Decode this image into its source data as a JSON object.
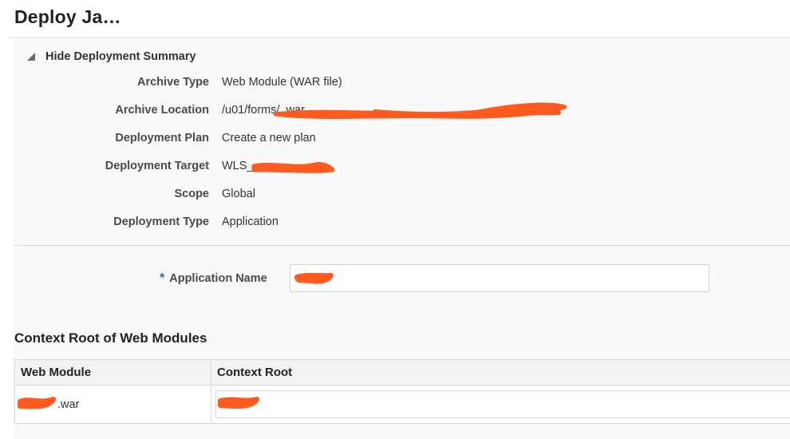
{
  "page": {
    "title": "Deploy Ja…"
  },
  "summary": {
    "toggle_label": "Hide Deployment Summary",
    "rows": [
      {
        "label": "Archive Type",
        "value": "Web Module (WAR file)"
      },
      {
        "label": "Archive Location",
        "value": "/u01/forms/                                                    .war"
      },
      {
        "label": "Deployment Plan",
        "value": "Create a new plan"
      },
      {
        "label": "Deployment Target",
        "value": "WLS_"
      },
      {
        "label": "Scope",
        "value": "Global"
      },
      {
        "label": "Deployment Type",
        "value": "Application"
      }
    ]
  },
  "app_name": {
    "required_marker": "*",
    "label": "Application Name",
    "value": ""
  },
  "context_root": {
    "heading": "Context Root of Web Modules",
    "columns": [
      "Web Module",
      "Context Root"
    ],
    "rows": [
      {
        "web_module": ".war",
        "context_root": ""
      }
    ]
  },
  "colors": {
    "redaction": "#ff5a1f",
    "required": "#1a6ecf"
  },
  "icons": {
    "toggle": "triangle-collapse-icon"
  }
}
